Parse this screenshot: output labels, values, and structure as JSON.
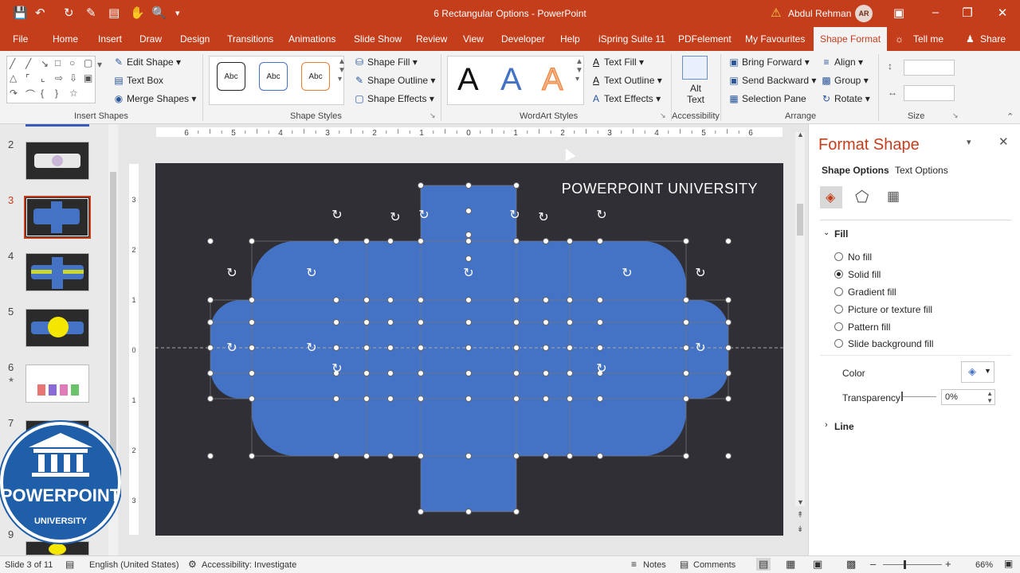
{
  "window": {
    "title": "6 Rectangular Options  -  PowerPoint",
    "user_name": "Abdul Rehman",
    "user_initials": "AR"
  },
  "tabs": [
    "File",
    "Home",
    "Insert",
    "Draw",
    "Design",
    "Transitions",
    "Animations",
    "Slide Show",
    "Review",
    "View",
    "Developer",
    "Help",
    "iSpring Suite 11",
    "PDFelement",
    "My Favourites",
    "Shape Format",
    "Tell me",
    "Share"
  ],
  "ribbon": {
    "insert_shapes": {
      "edit_shape": "Edit Shape",
      "text_box": "Text Box",
      "merge_shapes": "Merge Shapes",
      "label": "Insert Shapes"
    },
    "shape_styles": {
      "sample": "Abc",
      "fill": "Shape Fill",
      "outline": "Shape Outline",
      "effects": "Shape Effects",
      "label": "Shape Styles"
    },
    "wordart": {
      "letter": "A",
      "text_fill": "Text Fill",
      "text_outline": "Text Outline",
      "text_effects": "Text Effects",
      "label": "WordArt Styles"
    },
    "accessibility": {
      "alt_text_1": "Alt",
      "alt_text_2": "Text",
      "label": "Accessibility"
    },
    "arrange": {
      "bring_forward": "Bring Forward",
      "send_backward": "Send Backward",
      "selection_pane": "Selection Pane",
      "align": "Align",
      "group": "Group",
      "rotate": "Rotate",
      "label": "Arrange"
    },
    "size": {
      "label": "Size"
    }
  },
  "slides": {
    "numbers": [
      "2",
      "3",
      "4",
      "5",
      "6",
      "7",
      "9"
    ],
    "selected": "3"
  },
  "slide": {
    "title_text": "POWERPOINT UNIVERSITY"
  },
  "ruler": {
    "h_ticks": [
      "6",
      "5",
      "4",
      "3",
      "2",
      "1",
      "0",
      "1",
      "2",
      "3",
      "4",
      "5",
      "6"
    ],
    "v_ticks": [
      "3",
      "2",
      "1",
      "0",
      "1",
      "2",
      "3"
    ]
  },
  "format_pane": {
    "title": "Format Shape",
    "tab_shape": "Shape Options",
    "tab_text": "Text Options",
    "section_fill": "Fill",
    "options": [
      "No fill",
      "Solid fill",
      "Gradient fill",
      "Picture or texture fill",
      "Pattern fill",
      "Slide background fill"
    ],
    "selected_option": "Solid fill",
    "color_label": "Color",
    "transparency_label": "Transparency",
    "transparency_value": "0%",
    "section_line": "Line"
  },
  "status": {
    "slide_info": "Slide 3 of 11",
    "language": "English (United States)",
    "accessibility": "Accessibility: Investigate",
    "notes": "Notes",
    "comments": "Comments",
    "zoom": "66%"
  },
  "logo": {
    "line1": "POWERPOINT",
    "line2": "UNIVERSITY"
  },
  "colors": {
    "accent": "#c43e1c",
    "shape_fill": "#4472c4",
    "slide_bg": "#2f2f35"
  }
}
